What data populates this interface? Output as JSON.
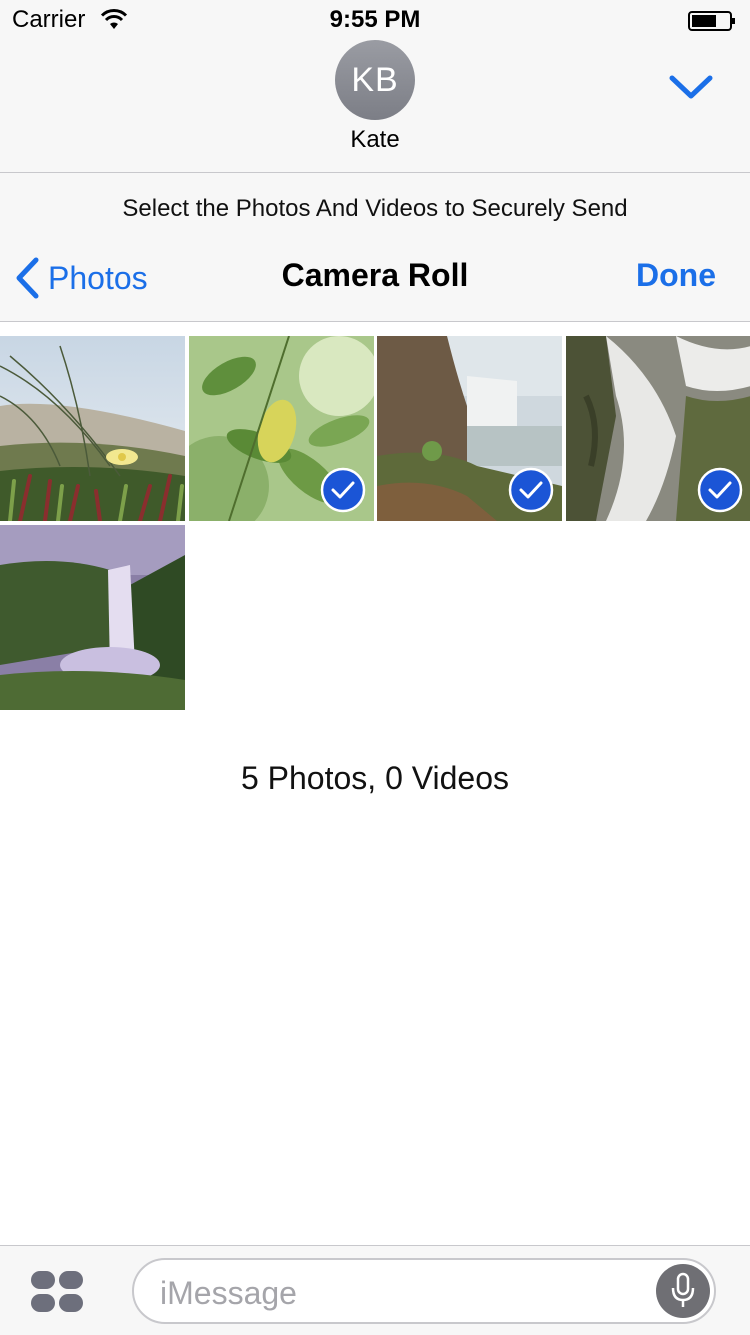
{
  "status": {
    "carrier": "Carrier",
    "time": "9:55 PM"
  },
  "contact": {
    "initials": "KB",
    "name": "Kate"
  },
  "picker": {
    "instruction": "Select the Photos And Videos to Securely Send",
    "back_label": "Photos",
    "title": "Camera Roll",
    "done_label": "Done"
  },
  "photos": [
    {
      "subject": "beach-grass-flower",
      "selected": false
    },
    {
      "subject": "green-leaves",
      "selected": true
    },
    {
      "subject": "waterfall-cliff",
      "selected": true
    },
    {
      "subject": "waterfall-long-exposure",
      "selected": true
    },
    {
      "subject": "waterfall-purple-dusk",
      "selected": false
    }
  ],
  "summary": "5 Photos, 0 Videos",
  "input": {
    "placeholder": "iMessage"
  },
  "colors": {
    "accent": "#1b6fe8",
    "check": "#1b55d6"
  }
}
